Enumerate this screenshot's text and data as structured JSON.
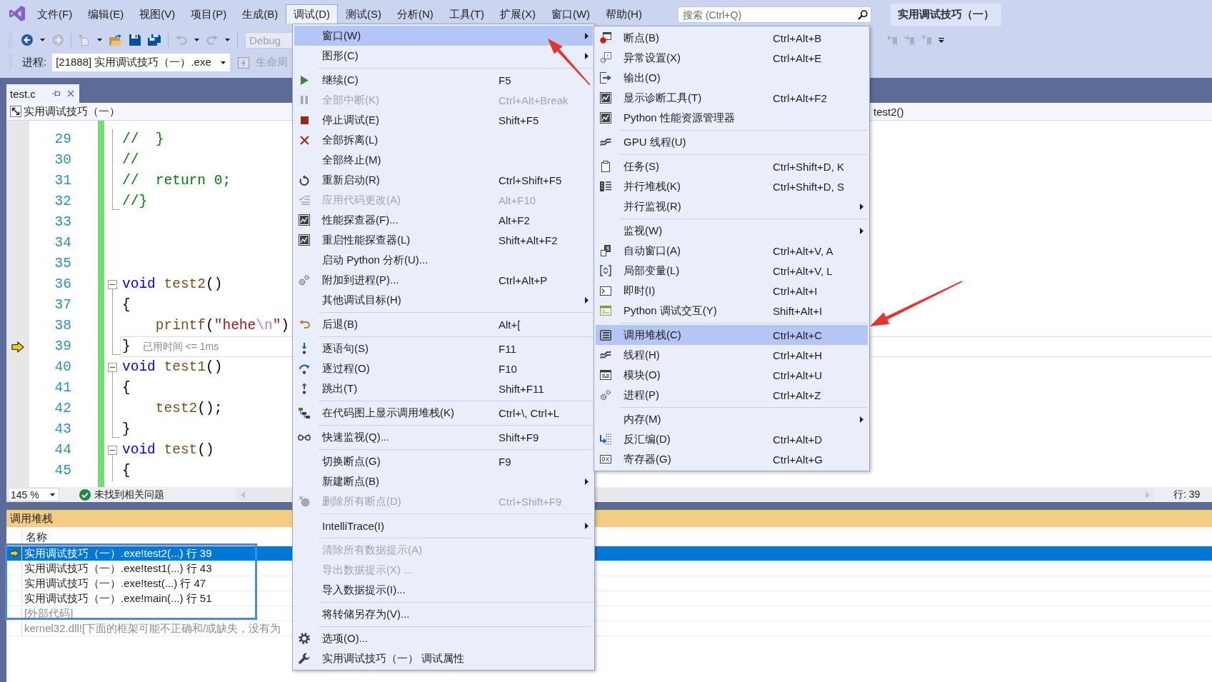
{
  "menubar": {
    "items": [
      {
        "label": "文件(F)",
        "selected": false
      },
      {
        "label": "编辑(E)",
        "selected": false
      },
      {
        "label": "视图(V)",
        "selected": false
      },
      {
        "label": "项目(P)",
        "selected": false
      },
      {
        "label": "生成(B)",
        "selected": false
      },
      {
        "label": "调试(D)",
        "selected": true
      },
      {
        "label": "测试(S)",
        "selected": false
      },
      {
        "label": "分析(N)",
        "selected": false
      },
      {
        "label": "工具(T)",
        "selected": false
      },
      {
        "label": "扩展(X)",
        "selected": false
      },
      {
        "label": "窗口(W)",
        "selected": false
      },
      {
        "label": "帮助(H)",
        "selected": false
      }
    ]
  },
  "search": {
    "placeholder": "搜索 (Ctrl+Q)"
  },
  "solution_name": "实用调试技巧（一）",
  "toolbar": {
    "configuration": {
      "value": "Debug",
      "disabled": true
    }
  },
  "process_bar": {
    "label": "进程:",
    "process": "[21888] 实用调试技巧（一）.exe",
    "lifecycle": {
      "label": "生命周",
      "disabled": true
    }
  },
  "tabs": [
    {
      "label": "test.c",
      "selected": true
    }
  ],
  "navigation": {
    "project": "实用调试技巧（一）",
    "function": "test2()"
  },
  "editor": {
    "lines": [
      {
        "number": "29",
        "tokens": [
          {
            "kind": "comment",
            "text": "//  }"
          }
        ],
        "kind": "inside",
        "current": false
      },
      {
        "number": "30",
        "tokens": [
          {
            "kind": "comment",
            "text": "//"
          }
        ],
        "kind": "inside",
        "current": false
      },
      {
        "number": "31",
        "tokens": [
          {
            "kind": "comment",
            "text": "//  return 0;"
          }
        ],
        "kind": "inside",
        "current": false
      },
      {
        "number": "32",
        "tokens": [
          {
            "kind": "comment",
            "text": "//}"
          }
        ],
        "kind": "end",
        "current": false
      },
      {
        "number": "33",
        "kind": "none",
        "current": false
      },
      {
        "number": "34",
        "kind": "none",
        "current": false
      },
      {
        "number": "35",
        "kind": "none",
        "current": false
      },
      {
        "number": "36",
        "tokens": [
          {
            "kind": "keyword",
            "text": "void"
          },
          {
            "kind": "function",
            "text": " test2"
          },
          {
            "kind": "plain",
            "text": "()"
          }
        ],
        "kind": "start",
        "current": false
      },
      {
        "number": "37",
        "tokens": [
          {
            "kind": "plain",
            "text": "{"
          }
        ],
        "kind": "inside",
        "current": false
      },
      {
        "number": "38",
        "tokens": [
          {
            "kind": "function",
            "text": "    printf"
          },
          {
            "kind": "plain",
            "text": "("
          },
          {
            "kind": "string",
            "text": "\"hehe"
          },
          {
            "kind": "escape",
            "text": "\\n"
          },
          {
            "kind": "string",
            "text": "\""
          },
          {
            "kind": "plain",
            "text": ")"
          }
        ],
        "kind": "inside",
        "current": false
      },
      {
        "number": "39",
        "tokens": [
          {
            "kind": "plain",
            "text": "}"
          }
        ],
        "kind": "end",
        "current": true,
        "tip": "已用时间 <= 1ms"
      },
      {
        "number": "40",
        "tokens": [
          {
            "kind": "keyword",
            "text": "void"
          },
          {
            "kind": "function",
            "text": " test1"
          },
          {
            "kind": "plain",
            "text": "()"
          }
        ],
        "kind": "start",
        "current": false
      },
      {
        "number": "41",
        "tokens": [
          {
            "kind": "plain",
            "text": "{"
          }
        ],
        "kind": "inside",
        "current": false
      },
      {
        "number": "42",
        "tokens": [
          {
            "kind": "function",
            "text": "    test2"
          },
          {
            "kind": "plain",
            "text": "();"
          }
        ],
        "kind": "inside",
        "current": false
      },
      {
        "number": "43",
        "tokens": [
          {
            "kind": "plain",
            "text": "}"
          }
        ],
        "kind": "end",
        "current": false
      },
      {
        "number": "44",
        "tokens": [
          {
            "kind": "keyword",
            "text": "void"
          },
          {
            "kind": "function",
            "text": " test"
          },
          {
            "kind": "plain",
            "text": "()"
          }
        ],
        "kind": "start",
        "current": false
      },
      {
        "number": "45",
        "tokens": [
          {
            "kind": "plain",
            "text": "{"
          }
        ],
        "kind": "inside",
        "current": false
      }
    ]
  },
  "editor_status": {
    "zoom": "145 %",
    "issues": "未找到相关问题",
    "position": "行: 39"
  },
  "call_stack": {
    "title": "调用堆栈",
    "column": "名称",
    "rows": [
      {
        "text": "实用调试技巧（一）.exe!test2(...) 行 39",
        "selected": true,
        "current": true,
        "kind": "frame"
      },
      {
        "text": "实用调试技巧（一）.exe!test1(...) 行 43",
        "selected": false,
        "current": false,
        "kind": "frame"
      },
      {
        "text": "实用调试技巧（一）.exe!test(...) 行 47",
        "selected": false,
        "current": false,
        "kind": "frame"
      },
      {
        "text": "实用调试技巧（一）.exe!main(...) 行 51",
        "selected": false,
        "current": false,
        "kind": "frame"
      },
      {
        "text": "[外部代码]",
        "selected": false,
        "current": false,
        "kind": "external"
      },
      {
        "text": "kernel32.dll![下面的框架可能不正确和/或缺失，没有为",
        "selected": false,
        "current": false,
        "kind": "external"
      }
    ]
  },
  "debug_menu": {
    "groups": [
      [
        {
          "label": "窗口(W)",
          "submenu": true,
          "disabled": false,
          "selected": true
        },
        {
          "label": "图形(C)",
          "submenu": true,
          "disabled": false,
          "selected": false
        }
      ],
      [
        {
          "label": "继续(C)",
          "shortcut": "F5",
          "submenu": false,
          "disabled": false,
          "selected": false
        },
        {
          "label": "全部中断(K)",
          "shortcut": "Ctrl+Alt+Break",
          "submenu": false,
          "disabled": true,
          "selected": false
        },
        {
          "label": "停止调试(E)",
          "shortcut": "Shift+F5",
          "submenu": false,
          "disabled": false,
          "selected": false
        },
        {
          "label": "全部拆离(L)",
          "submenu": false,
          "disabled": false,
          "selected": false
        },
        {
          "label": "全部终止(M)",
          "submenu": false,
          "disabled": false,
          "selected": false
        },
        {
          "label": "重新启动(R)",
          "shortcut": "Ctrl+Shift+F5",
          "submenu": false,
          "disabled": false,
          "selected": false
        },
        {
          "label": "应用代码更改(A)",
          "shortcut": "Alt+F10",
          "submenu": false,
          "disabled": true,
          "selected": false
        },
        {
          "label": "性能探查器(F)...",
          "shortcut": "Alt+F2",
          "submenu": false,
          "disabled": false,
          "selected": false
        },
        {
          "label": "重启性能探查器(L)",
          "shortcut": "Shift+Alt+F2",
          "submenu": false,
          "disabled": false,
          "selected": false
        },
        {
          "label": "启动 Python 分析(U)...",
          "submenu": false,
          "disabled": false,
          "selected": false
        },
        {
          "label": "附加到进程(P)...",
          "shortcut": "Ctrl+Alt+P",
          "submenu": false,
          "disabled": false,
          "selected": false
        },
        {
          "label": "其他调试目标(H)",
          "submenu": true,
          "disabled": false,
          "selected": false
        }
      ],
      [
        {
          "label": "后退(B)",
          "shortcut": "Alt+[",
          "submenu": false,
          "disabled": false,
          "selected": false
        }
      ],
      [
        {
          "label": "逐语句(S)",
          "shortcut": "F11",
          "submenu": false,
          "disabled": false,
          "selected": false
        },
        {
          "label": "逐过程(O)",
          "shortcut": "F10",
          "submenu": false,
          "disabled": false,
          "selected": false
        },
        {
          "label": "跳出(T)",
          "shortcut": "Shift+F11",
          "submenu": false,
          "disabled": false,
          "selected": false
        }
      ],
      [
        {
          "label": "在代码图上显示调用堆栈(K)",
          "shortcut": "Ctrl+\\, Ctrl+L",
          "submenu": false,
          "disabled": false,
          "selected": false
        }
      ],
      [
        {
          "label": "快速监视(Q)...",
          "shortcut": "Shift+F9",
          "submenu": false,
          "disabled": false,
          "selected": false
        }
      ],
      [
        {
          "label": "切换断点(G)",
          "shortcut": "F9",
          "submenu": false,
          "disabled": false,
          "selected": false
        },
        {
          "label": "新建断点(B)",
          "submenu": true,
          "disabled": false,
          "selected": false
        },
        {
          "label": "删除所有断点(D)",
          "shortcut": "Ctrl+Shift+F9",
          "submenu": false,
          "disabled": true,
          "selected": false
        }
      ],
      [
        {
          "label": "IntelliTrace(I)",
          "submenu": true,
          "disabled": false,
          "selected": false
        }
      ],
      [
        {
          "label": "清除所有数据提示(A)",
          "submenu": false,
          "disabled": true,
          "selected": false
        },
        {
          "label": "导出数据提示(X) ...",
          "submenu": false,
          "disabled": true,
          "selected": false
        },
        {
          "label": "导入数据提示(I)...",
          "submenu": false,
          "disabled": false,
          "selected": false
        }
      ],
      [
        {
          "label": "将转储另存为(V)...",
          "submenu": false,
          "disabled": false,
          "selected": false
        }
      ],
      [
        {
          "label": "选项(O)...",
          "submenu": false,
          "disabled": false,
          "selected": false
        },
        {
          "label": "实用调试技巧（一） 调试属性",
          "submenu": false,
          "disabled": false,
          "selected": false
        }
      ]
    ]
  },
  "window_submenu": {
    "groups": [
      [
        {
          "label": "断点(B)",
          "shortcut": "Ctrl+Alt+B",
          "submenu": false,
          "disabled": false,
          "selected": false
        },
        {
          "label": "异常设置(X)",
          "shortcut": "Ctrl+Alt+E",
          "submenu": false,
          "disabled": false,
          "selected": false
        },
        {
          "label": "输出(O)",
          "submenu": false,
          "disabled": false,
          "selected": false
        },
        {
          "label": "显示诊断工具(T)",
          "shortcut": "Ctrl+Alt+F2",
          "submenu": false,
          "disabled": false,
          "selected": false
        },
        {
          "label": "Python 性能资源管理器",
          "submenu": false,
          "disabled": false,
          "selected": false
        }
      ],
      [
        {
          "label": "GPU 线程(U)",
          "submenu": false,
          "disabled": false,
          "selected": false
        }
      ],
      [
        {
          "label": "任务(S)",
          "shortcut": "Ctrl+Shift+D, K",
          "submenu": false,
          "disabled": false,
          "selected": false
        },
        {
          "label": "并行堆栈(K)",
          "shortcut": "Ctrl+Shift+D, S",
          "submenu": false,
          "disabled": false,
          "selected": false
        },
        {
          "label": "并行监视(R)",
          "submenu": true,
          "disabled": false,
          "selected": false
        }
      ],
      [
        {
          "label": "监视(W)",
          "submenu": true,
          "disabled": false,
          "selected": false
        },
        {
          "label": "自动窗口(A)",
          "shortcut": "Ctrl+Alt+V, A",
          "submenu": false,
          "disabled": false,
          "selected": false
        },
        {
          "label": "局部变量(L)",
          "shortcut": "Ctrl+Alt+V, L",
          "submenu": false,
          "disabled": false,
          "selected": false
        },
        {
          "label": "即时(I)",
          "shortcut": "Ctrl+Alt+I",
          "submenu": false,
          "disabled": false,
          "selected": false
        },
        {
          "label": "Python 调试交互(Y)",
          "shortcut": "Shift+Alt+I",
          "submenu": false,
          "disabled": false,
          "selected": false
        }
      ],
      [
        {
          "label": "调用堆栈(C)",
          "shortcut": "Ctrl+Alt+C",
          "submenu": false,
          "disabled": false,
          "selected": true
        },
        {
          "label": "线程(H)",
          "shortcut": "Ctrl+Alt+H",
          "submenu": false,
          "disabled": false,
          "selected": false
        },
        {
          "label": "模块(O)",
          "shortcut": "Ctrl+Alt+U",
          "submenu": false,
          "disabled": false,
          "selected": false
        },
        {
          "label": "进程(P)",
          "shortcut": "Ctrl+Alt+Z",
          "submenu": false,
          "disabled": false,
          "selected": false
        }
      ],
      [
        {
          "label": "内存(M)",
          "submenu": true,
          "disabled": false,
          "selected": false
        },
        {
          "label": "反汇编(D)",
          "shortcut": "Ctrl+Alt+D",
          "submenu": false,
          "disabled": false,
          "selected": false
        },
        {
          "label": "寄存器(G)",
          "shortcut": "Ctrl+Alt+G",
          "submenu": false,
          "disabled": false,
          "selected": false
        }
      ]
    ]
  }
}
